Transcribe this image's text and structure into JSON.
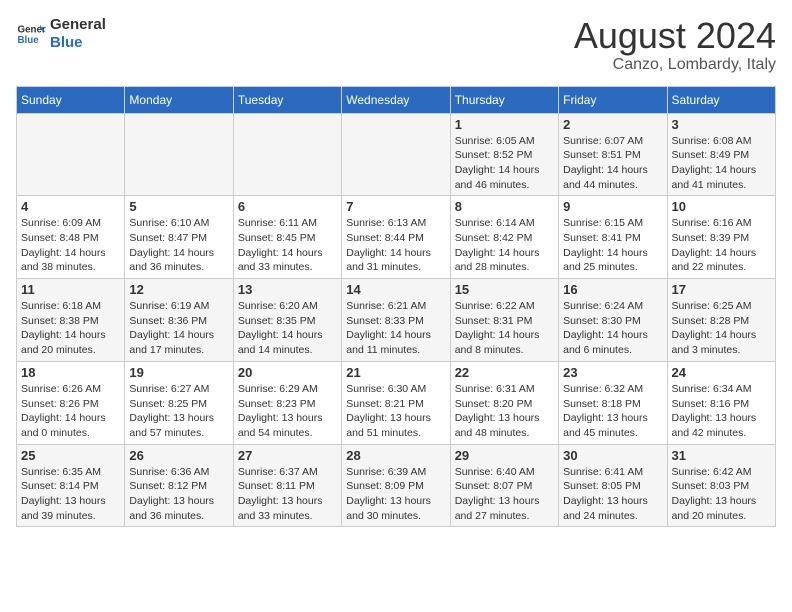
{
  "header": {
    "logo_general": "General",
    "logo_blue": "Blue",
    "month_year": "August 2024",
    "location": "Canzo, Lombardy, Italy"
  },
  "days_of_week": [
    "Sunday",
    "Monday",
    "Tuesday",
    "Wednesday",
    "Thursday",
    "Friday",
    "Saturday"
  ],
  "weeks": [
    [
      {
        "day": "",
        "info": ""
      },
      {
        "day": "",
        "info": ""
      },
      {
        "day": "",
        "info": ""
      },
      {
        "day": "",
        "info": ""
      },
      {
        "day": "1",
        "info": "Sunrise: 6:05 AM\nSunset: 8:52 PM\nDaylight: 14 hours\nand 46 minutes."
      },
      {
        "day": "2",
        "info": "Sunrise: 6:07 AM\nSunset: 8:51 PM\nDaylight: 14 hours\nand 44 minutes."
      },
      {
        "day": "3",
        "info": "Sunrise: 6:08 AM\nSunset: 8:49 PM\nDaylight: 14 hours\nand 41 minutes."
      }
    ],
    [
      {
        "day": "4",
        "info": "Sunrise: 6:09 AM\nSunset: 8:48 PM\nDaylight: 14 hours\nand 38 minutes."
      },
      {
        "day": "5",
        "info": "Sunrise: 6:10 AM\nSunset: 8:47 PM\nDaylight: 14 hours\nand 36 minutes."
      },
      {
        "day": "6",
        "info": "Sunrise: 6:11 AM\nSunset: 8:45 PM\nDaylight: 14 hours\nand 33 minutes."
      },
      {
        "day": "7",
        "info": "Sunrise: 6:13 AM\nSunset: 8:44 PM\nDaylight: 14 hours\nand 31 minutes."
      },
      {
        "day": "8",
        "info": "Sunrise: 6:14 AM\nSunset: 8:42 PM\nDaylight: 14 hours\nand 28 minutes."
      },
      {
        "day": "9",
        "info": "Sunrise: 6:15 AM\nSunset: 8:41 PM\nDaylight: 14 hours\nand 25 minutes."
      },
      {
        "day": "10",
        "info": "Sunrise: 6:16 AM\nSunset: 8:39 PM\nDaylight: 14 hours\nand 22 minutes."
      }
    ],
    [
      {
        "day": "11",
        "info": "Sunrise: 6:18 AM\nSunset: 8:38 PM\nDaylight: 14 hours\nand 20 minutes."
      },
      {
        "day": "12",
        "info": "Sunrise: 6:19 AM\nSunset: 8:36 PM\nDaylight: 14 hours\nand 17 minutes."
      },
      {
        "day": "13",
        "info": "Sunrise: 6:20 AM\nSunset: 8:35 PM\nDaylight: 14 hours\nand 14 minutes."
      },
      {
        "day": "14",
        "info": "Sunrise: 6:21 AM\nSunset: 8:33 PM\nDaylight: 14 hours\nand 11 minutes."
      },
      {
        "day": "15",
        "info": "Sunrise: 6:22 AM\nSunset: 8:31 PM\nDaylight: 14 hours\nand 8 minutes."
      },
      {
        "day": "16",
        "info": "Sunrise: 6:24 AM\nSunset: 8:30 PM\nDaylight: 14 hours\nand 6 minutes."
      },
      {
        "day": "17",
        "info": "Sunrise: 6:25 AM\nSunset: 8:28 PM\nDaylight: 14 hours\nand 3 minutes."
      }
    ],
    [
      {
        "day": "18",
        "info": "Sunrise: 6:26 AM\nSunset: 8:26 PM\nDaylight: 14 hours\nand 0 minutes."
      },
      {
        "day": "19",
        "info": "Sunrise: 6:27 AM\nSunset: 8:25 PM\nDaylight: 13 hours\nand 57 minutes."
      },
      {
        "day": "20",
        "info": "Sunrise: 6:29 AM\nSunset: 8:23 PM\nDaylight: 13 hours\nand 54 minutes."
      },
      {
        "day": "21",
        "info": "Sunrise: 6:30 AM\nSunset: 8:21 PM\nDaylight: 13 hours\nand 51 minutes."
      },
      {
        "day": "22",
        "info": "Sunrise: 6:31 AM\nSunset: 8:20 PM\nDaylight: 13 hours\nand 48 minutes."
      },
      {
        "day": "23",
        "info": "Sunrise: 6:32 AM\nSunset: 8:18 PM\nDaylight: 13 hours\nand 45 minutes."
      },
      {
        "day": "24",
        "info": "Sunrise: 6:34 AM\nSunset: 8:16 PM\nDaylight: 13 hours\nand 42 minutes."
      }
    ],
    [
      {
        "day": "25",
        "info": "Sunrise: 6:35 AM\nSunset: 8:14 PM\nDaylight: 13 hours\nand 39 minutes."
      },
      {
        "day": "26",
        "info": "Sunrise: 6:36 AM\nSunset: 8:12 PM\nDaylight: 13 hours\nand 36 minutes."
      },
      {
        "day": "27",
        "info": "Sunrise: 6:37 AM\nSunset: 8:11 PM\nDaylight: 13 hours\nand 33 minutes."
      },
      {
        "day": "28",
        "info": "Sunrise: 6:39 AM\nSunset: 8:09 PM\nDaylight: 13 hours\nand 30 minutes."
      },
      {
        "day": "29",
        "info": "Sunrise: 6:40 AM\nSunset: 8:07 PM\nDaylight: 13 hours\nand 27 minutes."
      },
      {
        "day": "30",
        "info": "Sunrise: 6:41 AM\nSunset: 8:05 PM\nDaylight: 13 hours\nand 24 minutes."
      },
      {
        "day": "31",
        "info": "Sunrise: 6:42 AM\nSunset: 8:03 PM\nDaylight: 13 hours\nand 20 minutes."
      }
    ]
  ]
}
